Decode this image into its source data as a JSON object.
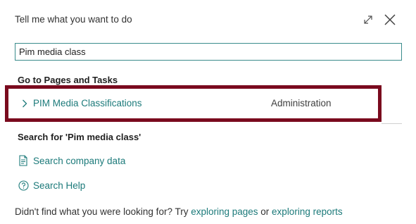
{
  "header": {
    "title": "Tell me what you want to do",
    "expand_icon": "expand-icon",
    "close_icon": "close-icon"
  },
  "search": {
    "value": "Pim media class"
  },
  "pages_section": {
    "heading": "Go to Pages and Tasks",
    "results": [
      {
        "name": "PIM Media Classifications",
        "category": "Administration",
        "highlight_color": "#7a0a1e"
      }
    ]
  },
  "search_section": {
    "heading": "Search for 'Pim media class'",
    "actions": [
      {
        "label": "Search company data",
        "icon": "document-search-icon"
      },
      {
        "label": "Search Help",
        "icon": "help-circle-icon"
      }
    ]
  },
  "footer": {
    "prefix": "Didn't find what you were looking for? Try ",
    "link1": "exploring pages",
    "middle": " or ",
    "link2": "exploring reports"
  },
  "colors": {
    "link": "#1c7a7a",
    "input_border": "#3a8c8c",
    "highlight_border": "#7a0a1e"
  }
}
